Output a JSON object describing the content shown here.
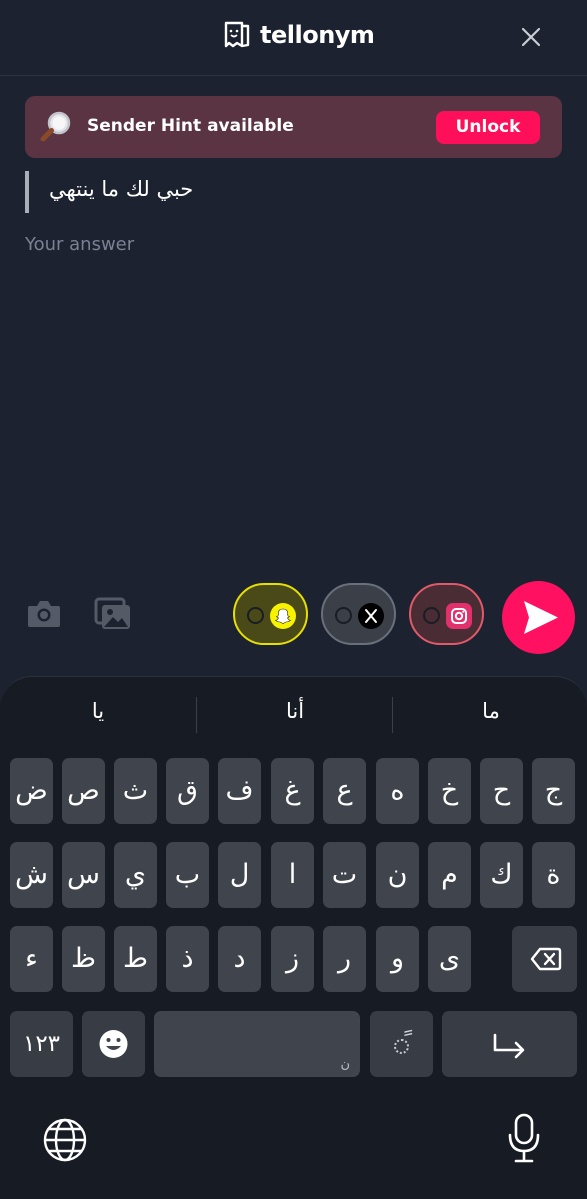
{
  "header": {
    "logo_text": "tellonym",
    "logo_icon": "tellonym-logo-icon",
    "close_icon": "close-icon"
  },
  "hint": {
    "icon": "magnifier-icon",
    "text": "Sender Hint available",
    "button": "Unlock"
  },
  "question": "حبي لك ما ينتهي",
  "answer": {
    "placeholder": "Your answer",
    "value": ""
  },
  "toolbar": {
    "camera_icon": "camera-icon",
    "gallery_icon": "gallery-icon",
    "share_toggles": [
      {
        "name": "snapchat",
        "accent": "#f7f200"
      },
      {
        "name": "x",
        "accent": "#000000"
      },
      {
        "name": "instagram",
        "accent": "#e1306c"
      }
    ],
    "send_icon": "send-icon"
  },
  "keyboard": {
    "suggestions": [
      "يا",
      "أنا",
      "ما"
    ],
    "row1": [
      "ض",
      "ص",
      "ث",
      "ق",
      "ف",
      "غ",
      "ع",
      "ه",
      "خ",
      "ح",
      "ج"
    ],
    "row2": [
      "ش",
      "س",
      "ي",
      "ب",
      "ل",
      "ا",
      "ت",
      "ن",
      "م",
      "ك",
      "ة"
    ],
    "row3": [
      "ء",
      "ظ",
      "ط",
      "ذ",
      "د",
      "ز",
      "ر",
      "و",
      "ى"
    ],
    "numbers_key": "١٢٣",
    "space_hint": "ن",
    "diacritic_key": "ً",
    "emoji_icon": "emoji-icon",
    "backspace_icon": "backspace-icon",
    "return_icon": "return-icon",
    "globe_icon": "globe-icon",
    "mic_icon": "microphone-icon"
  }
}
